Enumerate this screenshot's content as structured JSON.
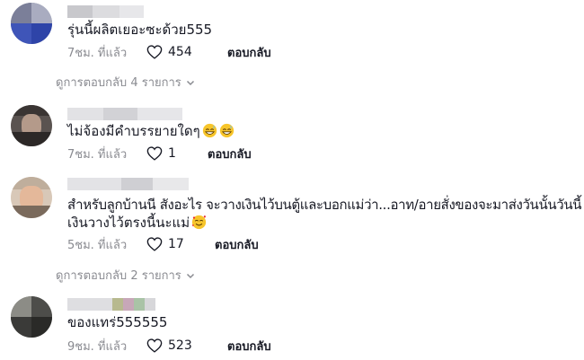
{
  "comments": [
    {
      "text": "รุ่นนี้ผลิตเยอะซะด้วย555",
      "time": "7ชม. ที่แล้ว",
      "likes": "454",
      "reply_label": "ตอบกลับ",
      "view_replies": "ดูการตอบกลับ 4 รายการ"
    },
    {
      "text": "ไม่จ้องมีคำบรรยายใดๆ",
      "emoji": [
        "grinning-sweat-emoji",
        "grinning-sweat-emoji"
      ],
      "time": "7ชม. ที่แล้ว",
      "likes": "1",
      "reply_label": "ตอบกลับ"
    },
    {
      "text_line1": "สำหรับลูกบ้านนี สังอะไร จะวางเงินไว้บนตู้และบอกแม่ว่า...อาท/อายสั่งของจะมาส่งวันนั้นวันนี้",
      "text_line2": "เงินวางไว้ตรงนี้นะแม่",
      "emoji": [
        "smiling-face-with-hearts-emoji"
      ],
      "time": "5ชม. ที่แล้ว",
      "likes": "17",
      "reply_label": "ตอบกลับ",
      "view_replies": "ดูการตอบกลับ 2 รายการ"
    },
    {
      "text": "ของแทร่555555",
      "time": "9ชม. ที่แล้ว",
      "likes": "523",
      "reply_label": "ตอบกลับ"
    }
  ],
  "colors": {
    "text_primary": "#161823",
    "text_secondary": "#8a8b91",
    "divider": "#e3e3e4"
  }
}
